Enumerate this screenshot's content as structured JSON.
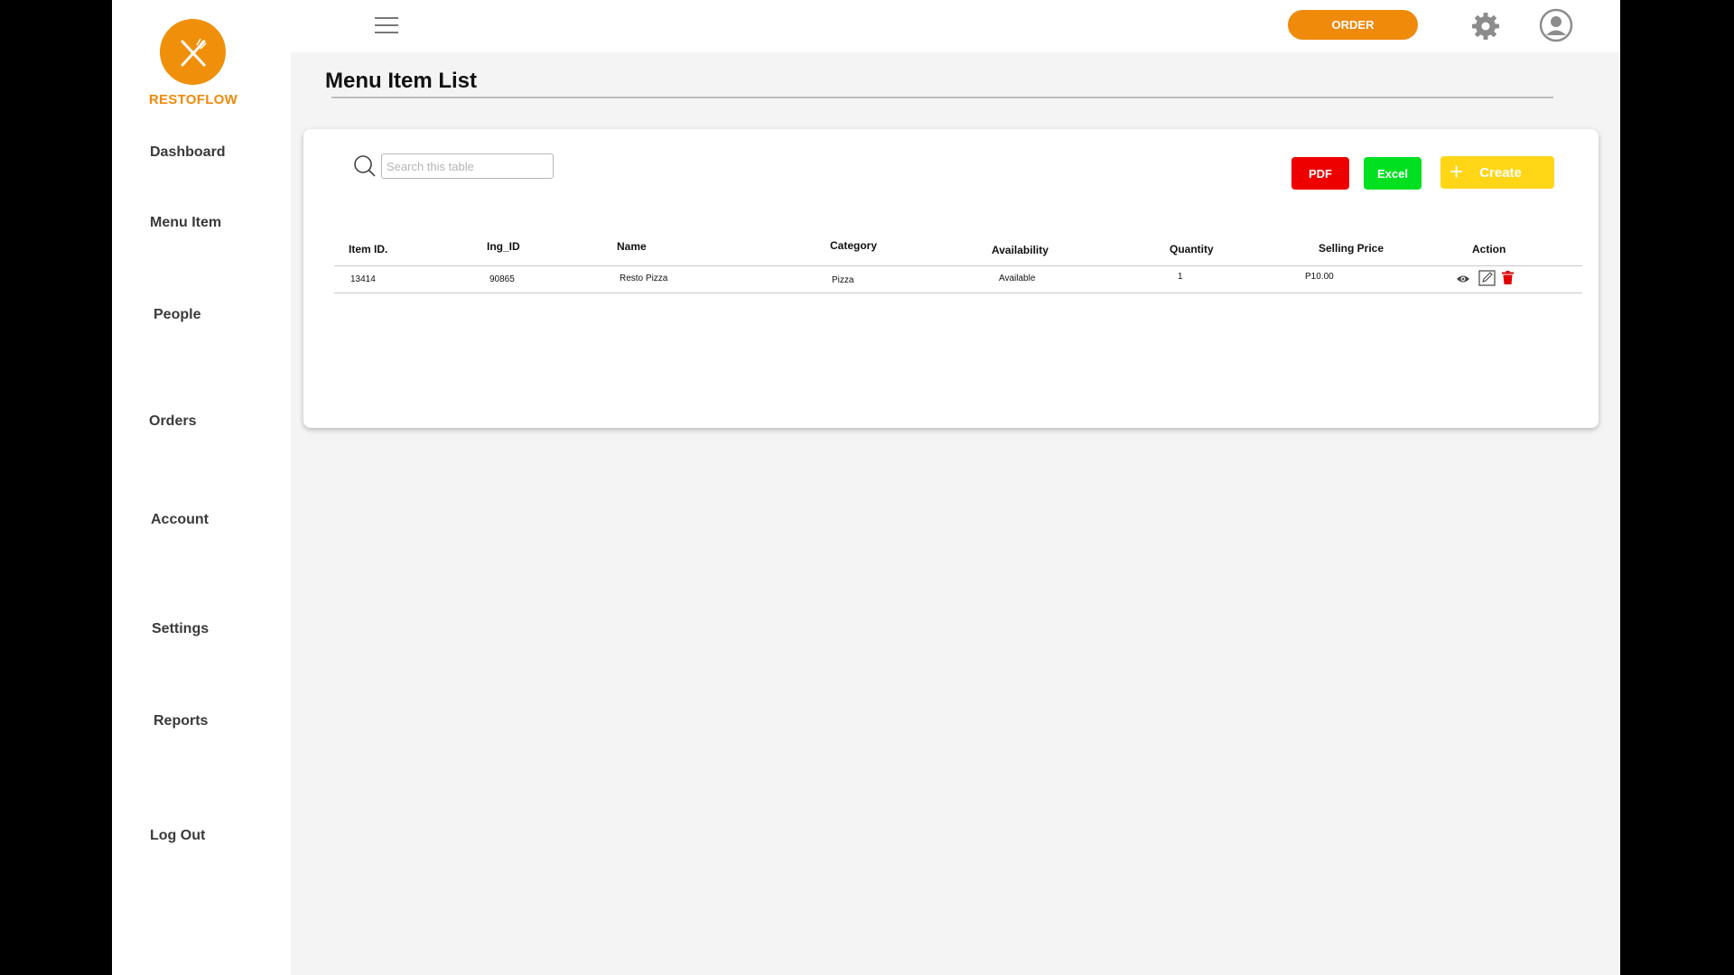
{
  "app": {
    "brand": "RESTOFLOW"
  },
  "sidebar": {
    "items": [
      {
        "label": "Dashboard"
      },
      {
        "label": "Menu Item"
      },
      {
        "label": "People"
      },
      {
        "label": "Orders"
      },
      {
        "label": "Account"
      },
      {
        "label": "Settings"
      },
      {
        "label": "Reports"
      },
      {
        "label": "Log Out"
      }
    ]
  },
  "topbar": {
    "order_label": "ORDER"
  },
  "page": {
    "title": "Menu Item List"
  },
  "toolbar": {
    "search_placeholder": "Search this table",
    "pdf_label": "PDF",
    "excel_label": "Excel",
    "create_label": "Create"
  },
  "table": {
    "headers": [
      "Item ID.",
      "Ing_ID",
      "Name",
      "Category",
      "Availability",
      "Quantity",
      "Selling Price",
      "Action"
    ],
    "rows": [
      {
        "item_id": "13414",
        "ing_id": "90865",
        "name": "Resto Pizza",
        "category": "Pizza",
        "availability": "Available",
        "quantity": "1",
        "selling_price": "P10.00"
      }
    ]
  },
  "colors": {
    "accent": "#EF8A0B",
    "pdf": "#EE0000",
    "excel": "#00E020",
    "create": "#FFD615",
    "delete": "#E00000"
  },
  "icons": [
    "logo-icon",
    "hamburger-icon",
    "gear-icon",
    "user-icon",
    "search-icon",
    "plus-icon",
    "eye-icon",
    "edit-icon",
    "trash-icon"
  ]
}
